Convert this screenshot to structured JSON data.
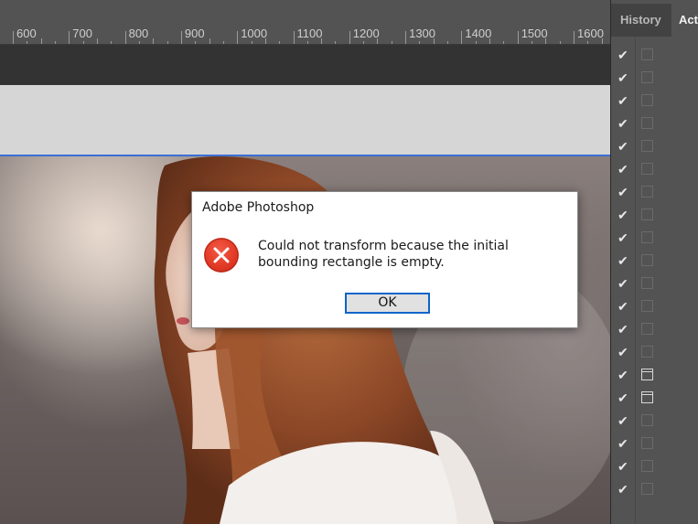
{
  "ruler": {
    "labels": [
      "600",
      "700",
      "800",
      "900",
      "1000",
      "1100",
      "1200",
      "1300",
      "1400",
      "1500",
      "1600"
    ]
  },
  "dialog": {
    "title": "Adobe Photoshop",
    "message": "Could not transform because the initial bounding rectangle is empty.",
    "ok_label": "OK",
    "icon": "error-icon"
  },
  "panel": {
    "tab_history": "History",
    "tab_actions": "Actions",
    "rows": [
      {
        "checked": true,
        "dialog": false
      },
      {
        "checked": true,
        "dialog": false
      },
      {
        "checked": true,
        "dialog": false
      },
      {
        "checked": true,
        "dialog": false
      },
      {
        "checked": true,
        "dialog": false
      },
      {
        "checked": true,
        "dialog": false
      },
      {
        "checked": true,
        "dialog": false
      },
      {
        "checked": true,
        "dialog": false
      },
      {
        "checked": true,
        "dialog": false
      },
      {
        "checked": true,
        "dialog": false
      },
      {
        "checked": true,
        "dialog": false
      },
      {
        "checked": true,
        "dialog": false
      },
      {
        "checked": true,
        "dialog": false
      },
      {
        "checked": true,
        "dialog": false
      },
      {
        "checked": true,
        "dialog": true
      },
      {
        "checked": true,
        "dialog": true
      },
      {
        "checked": true,
        "dialog": false
      },
      {
        "checked": true,
        "dialog": false
      },
      {
        "checked": true,
        "dialog": false
      },
      {
        "checked": true,
        "dialog": false
      }
    ]
  },
  "colors": {
    "selection_border": "#3b6fd6",
    "ok_border": "#0a64c8",
    "error_red": "#e23a26"
  }
}
